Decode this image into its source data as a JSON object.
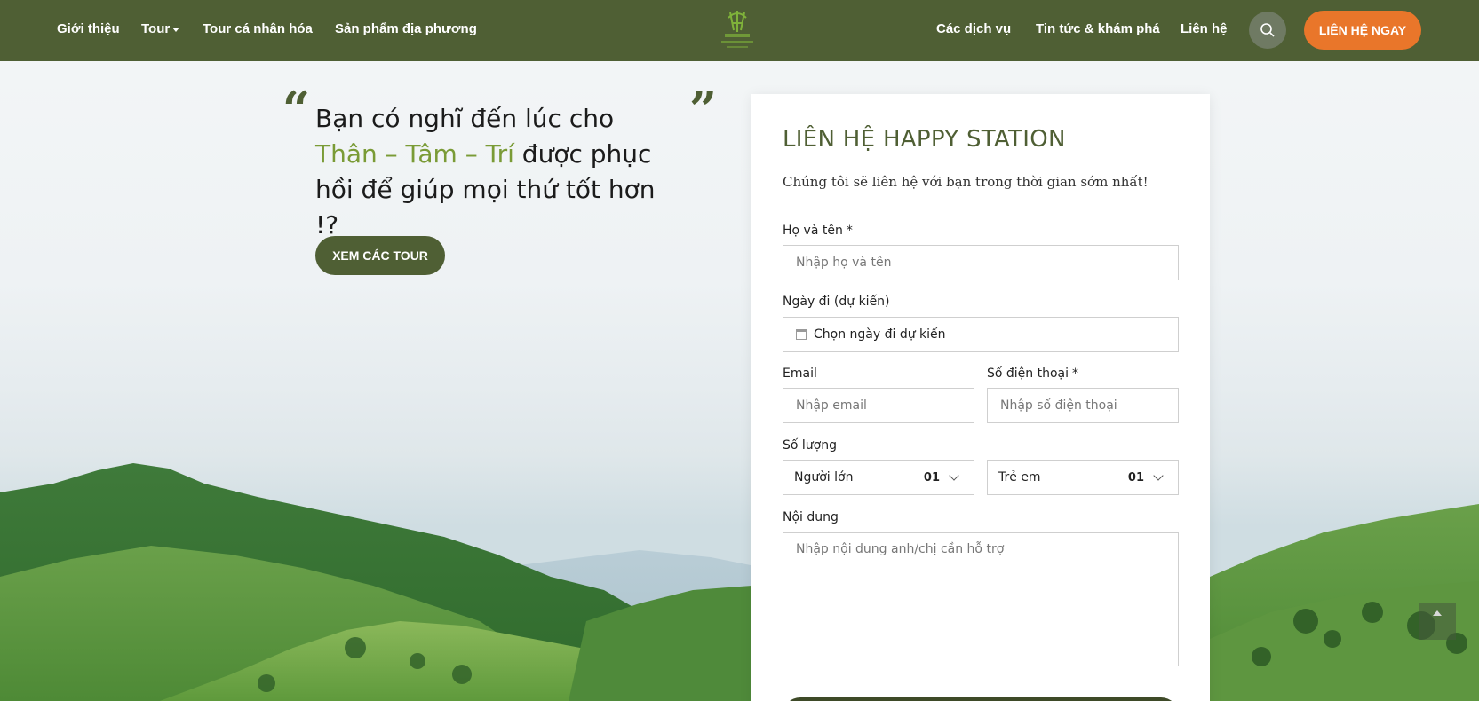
{
  "header": {
    "nav_left": [
      "Giới thiệu",
      "Tour",
      "Tour cá nhân hóa",
      "Sản phẩm địa phương"
    ],
    "nav_right": [
      "Các dịch vụ",
      "Tin tức & khám phá",
      "Liên hệ"
    ],
    "cta_label": "LIÊN HỆ NGAY"
  },
  "hero": {
    "headline_part1": "Bạn có nghĩ đến lúc cho ",
    "headline_highlight": "Thân – Tâm – Trí",
    "headline_part2": " được phục hồi để giúp mọi thứ tốt hơn !?",
    "tour_button": "XEM CÁC TOUR"
  },
  "form": {
    "title": "LIÊN HỆ HAPPY STATION",
    "subtitle": "Chúng tôi sẽ liên hệ với bạn trong thời gian sớm nhất!",
    "name_label": "Họ và tên",
    "name_placeholder": "Nhập họ và tên",
    "date_label": "Ngày đi (dự kiến)",
    "date_value": "Chọn ngày đi dự kiến",
    "email_label": "Email",
    "email_placeholder": "Nhập email",
    "phone_label": "Số điện thoại",
    "phone_placeholder": "Nhập số điện thoại",
    "quantity_label": "Số lượng",
    "adults_label": "Người lớn",
    "adults_value": "01",
    "children_label": "Trẻ em",
    "children_value": "01",
    "content_label": "Nội dung",
    "content_placeholder": "Nhập nội dung anh/chị cần hỗ trợ",
    "required_mark": "*"
  },
  "colors": {
    "header_bg": "#4f5f34",
    "cta": "#e9762a",
    "accent_green": "#7a9b36",
    "title_green": "#4f5f34"
  },
  "icons": [
    "search-icon",
    "calendar-icon",
    "chevron-down-icon",
    "caret-down-icon",
    "arrow-up-icon",
    "logo"
  ]
}
